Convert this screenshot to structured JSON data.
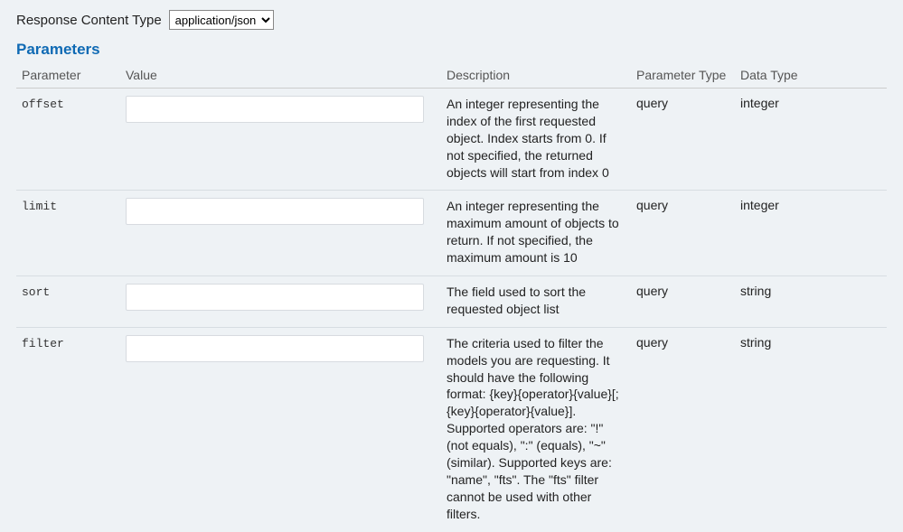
{
  "response": {
    "label": "Response Content Type",
    "selected": "application/json",
    "options": [
      "application/json"
    ]
  },
  "parameters_heading": "Parameters",
  "headers": {
    "parameter": "Parameter",
    "value": "Value",
    "description": "Description",
    "parameter_type": "Parameter Type",
    "data_type": "Data Type"
  },
  "params": [
    {
      "name": "offset",
      "value": "",
      "description": "An integer representing the index of the first requested object. Index starts from 0. If not specified, the returned objects will start from index 0",
      "parameter_type": "query",
      "data_type": "integer"
    },
    {
      "name": "limit",
      "value": "",
      "description": "An integer representing the maximum amount of objects to return. If not specified, the maximum amount is 10",
      "parameter_type": "query",
      "data_type": "integer"
    },
    {
      "name": "sort",
      "value": "",
      "description": "The field used to sort the requested object list",
      "parameter_type": "query",
      "data_type": "string"
    },
    {
      "name": "filter",
      "value": "",
      "description": "The criteria used to filter the models you are requesting. It should have the following format: {key}{operator}{value}[;{key}{operator}{value}]. Supported operators are: \"!\" (not equals), \":\" (equals), \"~\" (similar). Supported keys are: \"name\", \"fts\". The \"fts\" filter cannot be used with other filters.",
      "parameter_type": "query",
      "data_type": "string"
    }
  ]
}
